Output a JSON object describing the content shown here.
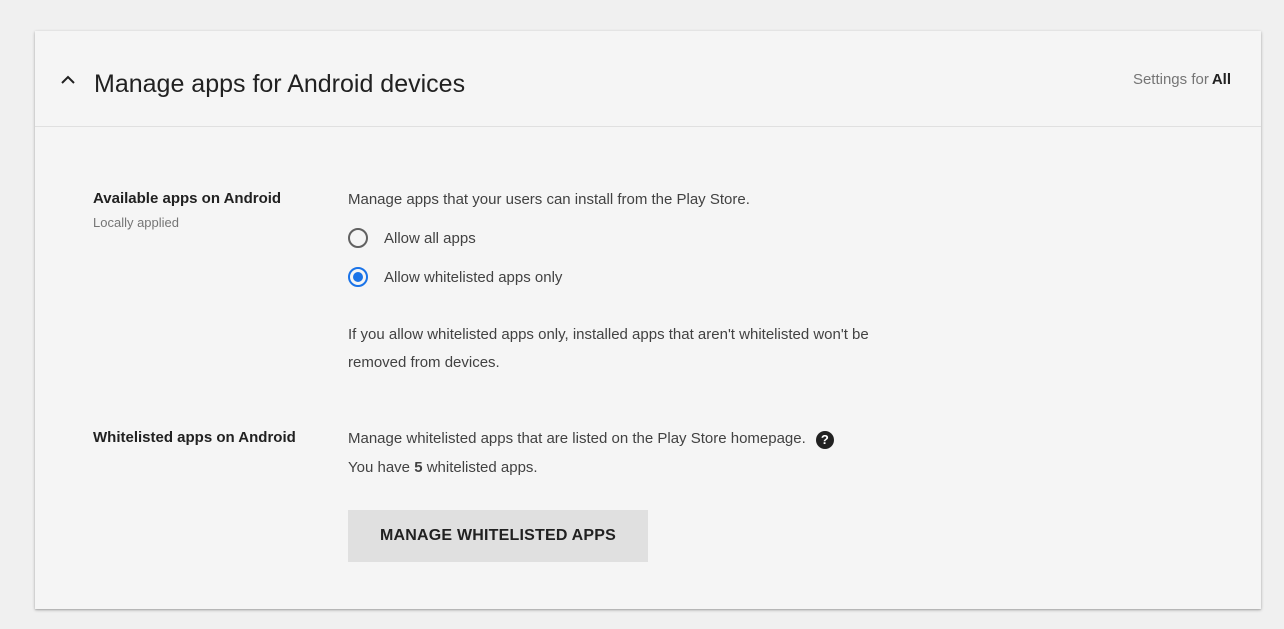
{
  "header": {
    "title": "Manage apps for Android devices",
    "settings_for_prefix": "Settings for",
    "settings_for_scope": "All"
  },
  "available_apps": {
    "label": "Available apps on Android",
    "sublabel": "Locally applied",
    "description": "Manage apps that your users can install from the Play Store.",
    "options": [
      {
        "label": "Allow all apps",
        "selected": false
      },
      {
        "label": "Allow whitelisted apps only",
        "selected": true
      }
    ],
    "note_line1": "If you allow whitelisted apps only, installed apps that aren't whitelisted won't be",
    "note_line2": "removed from devices."
  },
  "whitelisted_apps": {
    "label": "Whitelisted apps on Android",
    "description": "Manage whitelisted apps that are listed on the Play Store homepage.",
    "help_glyph": "?",
    "count_prefix": "You have",
    "count": "5",
    "count_suffix": "whitelisted apps.",
    "button_label": "MANAGE WHITELISTED APPS"
  },
  "icons": {
    "collapse": "chevron-up-icon",
    "help": "help-icon"
  },
  "colors": {
    "accent": "#1a73e8",
    "button_bg": "#e0e0e0",
    "card_bg": "#f5f5f5"
  }
}
